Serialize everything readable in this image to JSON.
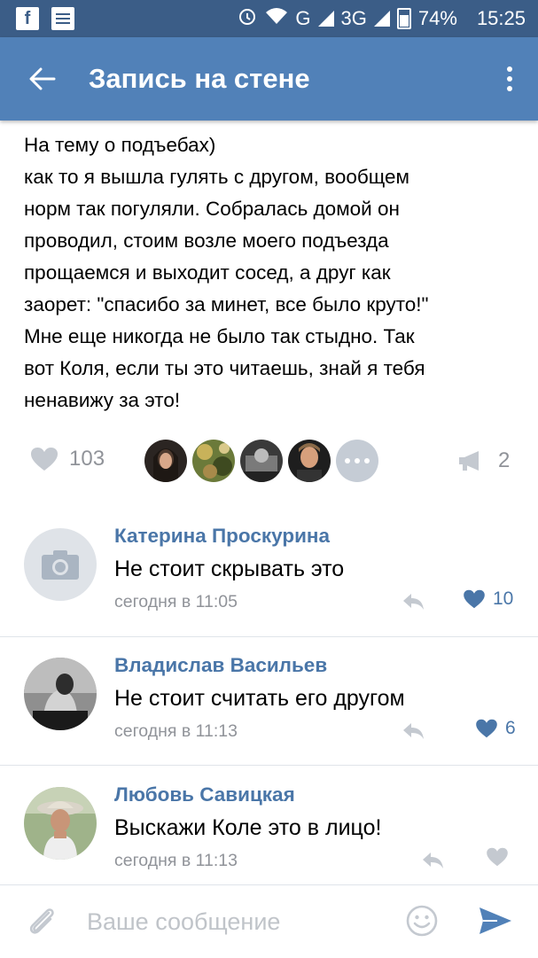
{
  "status_bar": {
    "signal_text": "G",
    "network_text": "3G",
    "battery": "74%",
    "time": "15:25"
  },
  "header": {
    "title": "Запись на стене"
  },
  "post": {
    "lines": [
      "На тему о подъебах)",
      "как то я вышла гулять с другом, вообщем",
      "норм так погуляли. Собралась домой он",
      "проводил, стоим возле моего подъезда",
      "прощаемся и выходит сосед, а друг как",
      "заорет: \"спасибо за минет, все было круто!\"",
      "Мне еще никогда не было так стыдно. Так",
      "вот Коля, если ты это читаешь, знай я тебя",
      "ненавижу за это!"
    ],
    "likes": "103",
    "shares": "2"
  },
  "comments": [
    {
      "author": "Катерина Проскурина",
      "text": "Не стоит скрывать это",
      "time": "сегодня в 11:05",
      "likes": "10"
    },
    {
      "author": "Владислав Васильев",
      "text": "Не стоит считать его другом",
      "time": "сегодня в 11:13",
      "likes": "6"
    },
    {
      "author": "Любовь Савицкая",
      "text": "Выскажи Коле это в лицо!",
      "time": "сегодня в 11:13",
      "likes": ""
    }
  ],
  "composer": {
    "placeholder": "Ваше сообщение"
  },
  "colors": {
    "status_bar": "#3b5d87",
    "app_bar": "#5181b8",
    "link_blue": "#4a76a8",
    "muted_gray": "#909399"
  },
  "icons": [
    "facebook-icon",
    "notes-icon",
    "alarm-icon",
    "wifi-icon",
    "back-arrow-icon",
    "more-vertical-icon",
    "heart-icon",
    "more-avatars-icon",
    "megaphone-share-icon",
    "camera-placeholder-icon",
    "reply-icon",
    "paperclip-icon",
    "emoji-icon",
    "send-icon"
  ]
}
